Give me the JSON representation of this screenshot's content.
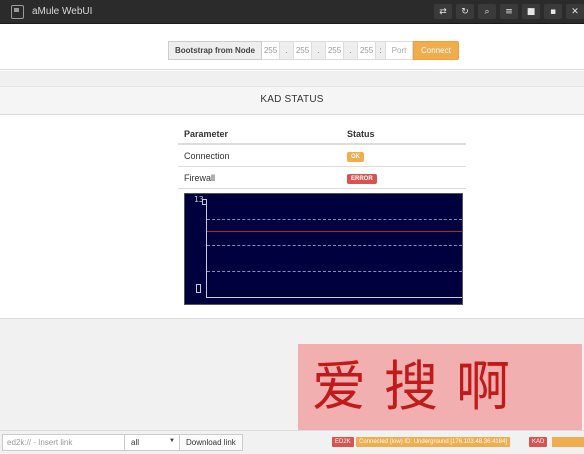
{
  "navbar": {
    "app_title": "aMule WebUI",
    "icons": [
      "swap-icon",
      "refresh-icon",
      "search-icon",
      "menu-icon",
      "settings-icon",
      "chart-icon",
      "close-icon"
    ],
    "icon_glyphs": [
      "⇄",
      "↻",
      "⌕",
      "≡",
      "■",
      "▪",
      "✕"
    ]
  },
  "bootstrap": {
    "label": "Bootstrap from Node",
    "ip_placeholders": [
      "255",
      "255",
      "255",
      "255"
    ],
    "dot": ".",
    "colon": ":",
    "port_placeholder": "Port",
    "connect_label": "Connect"
  },
  "kad_status": {
    "title": "KAD STATUS",
    "headers": {
      "parameter": "Parameter",
      "status": "Status"
    },
    "rows": [
      {
        "parameter": "Connection",
        "status": "OK",
        "status_color": "#f0ad4e"
      },
      {
        "parameter": "Firewall",
        "status": "ERROR",
        "status_color": "#d9534f"
      }
    ]
  },
  "graph": {
    "top_label": "13",
    "background": "#00003e",
    "line_color": "#bb2222"
  },
  "footer": {
    "ed2k_placeholder": "ed2k:// - Insert link",
    "category_selected": "all",
    "download_label": "Download link",
    "ed2k_status": "ED2K",
    "connection_status": "Connected (low) ID: Underground [176.103.48.36:4184]",
    "kad_status": "KAD"
  },
  "watermark": {
    "text": "爱搜啊"
  }
}
